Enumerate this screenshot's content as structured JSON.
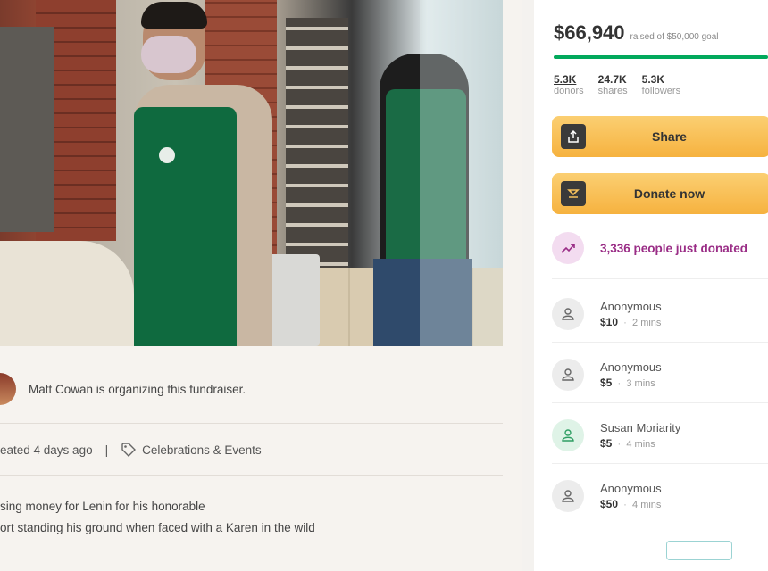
{
  "organizer": {
    "text": "Matt Cowan is organizing this fundraiser."
  },
  "meta": {
    "created": "eated 4 days ago",
    "category": "Celebrations & Events"
  },
  "description": {
    "line1": "sing money for Lenin for his honorable",
    "line2": "ort standing his ground when faced with a Karen in the wild"
  },
  "summary": {
    "raised": "$66,940",
    "goal": "raised of $50,000 goal",
    "progress": 1.0,
    "stats": [
      {
        "num": "5.3K",
        "label": "donors"
      },
      {
        "num": "24.7K",
        "label": "shares"
      },
      {
        "num": "5.3K",
        "label": "followers"
      }
    ]
  },
  "buttons": {
    "share": "Share",
    "donate": "Donate now"
  },
  "trend": {
    "text": "3,336 people just donated"
  },
  "donations": [
    {
      "name": "Anonymous",
      "amount": "$10",
      "time": "2 mins"
    },
    {
      "name": "Anonymous",
      "amount": "$5",
      "time": "3 mins"
    },
    {
      "name": "Susan Moriarity",
      "amount": "$5",
      "time": "4 mins"
    },
    {
      "name": "Anonymous",
      "amount": "$50",
      "time": "4 mins"
    }
  ],
  "colors": {
    "accent_green": "#02a95c",
    "button_yellow": "#f6b23f",
    "trend_purple": "#9a2d86"
  }
}
